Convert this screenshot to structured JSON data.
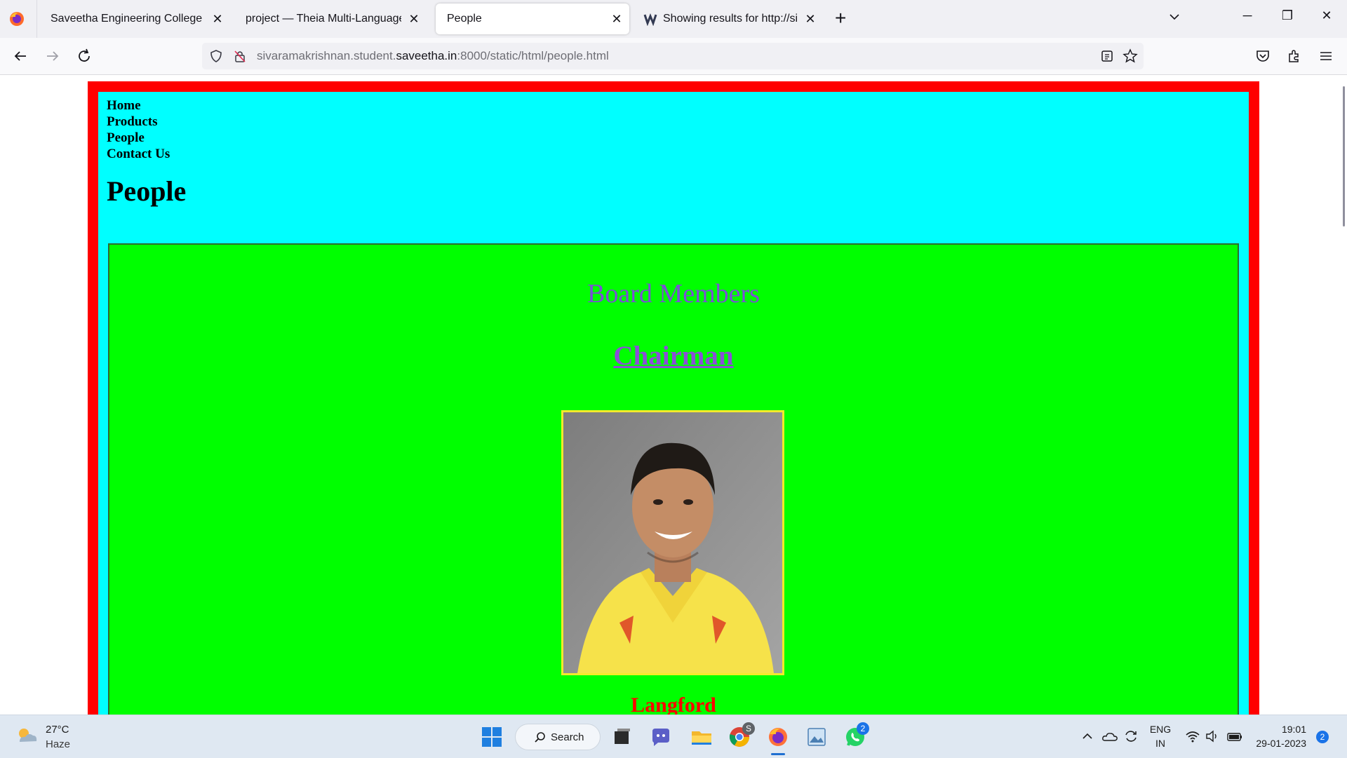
{
  "browser": {
    "tabs": [
      {
        "title": "Saveetha Engineering College",
        "active": false
      },
      {
        "title": "project — Theia Multi-Language Ex",
        "active": false
      },
      {
        "title": "People",
        "active": true
      },
      {
        "title": "Showing results for http://sivara",
        "active": false
      }
    ],
    "url": {
      "prefix": "sivaramakrishnan.student.",
      "domain": "saveetha.in",
      "suffix": ":8000/static/html/people.html"
    }
  },
  "page": {
    "nav": [
      "Home",
      "Products",
      "People",
      "Contact Us"
    ],
    "heading": "People",
    "section_title": "Board Members",
    "role": "Chairman",
    "person_name": "Langford",
    "colors": {
      "outer_border": "#ff0000",
      "inner_background": "#00ffff",
      "section_background": "#00ff00",
      "section_title": "#7b4fd6",
      "person_name": "#ff0000",
      "photo_border": "#f5ea2b"
    }
  },
  "taskbar": {
    "weather": {
      "temp": "27°C",
      "desc": "Haze"
    },
    "search_label": "Search",
    "tray": {
      "lang_top": "ENG",
      "lang_bottom": "IN",
      "time": "19:01",
      "date": "29-01-2023",
      "notifications": "2"
    },
    "badges": {
      "chrome": "S",
      "whatsapp": "2"
    }
  }
}
